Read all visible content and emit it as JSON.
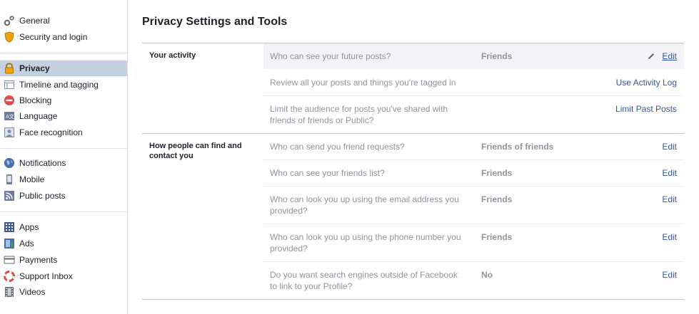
{
  "sidebar": {
    "groups": [
      [
        {
          "label": "General",
          "icon": "gear-icon"
        },
        {
          "label": "Security and login",
          "icon": "shield-icon"
        }
      ],
      [
        {
          "label": "Privacy",
          "icon": "lock-icon",
          "active": true
        },
        {
          "label": "Timeline and tagging",
          "icon": "timeline-icon"
        },
        {
          "label": "Blocking",
          "icon": "block-icon"
        },
        {
          "label": "Language",
          "icon": "language-icon"
        },
        {
          "label": "Face recognition",
          "icon": "face-recognition-icon"
        }
      ],
      [
        {
          "label": "Notifications",
          "icon": "globe-icon"
        },
        {
          "label": "Mobile",
          "icon": "mobile-icon"
        },
        {
          "label": "Public posts",
          "icon": "rss-icon"
        }
      ],
      [
        {
          "label": "Apps",
          "icon": "apps-icon"
        },
        {
          "label": "Ads",
          "icon": "ads-icon"
        },
        {
          "label": "Payments",
          "icon": "payments-icon"
        },
        {
          "label": "Support Inbox",
          "icon": "lifebuoy-icon"
        },
        {
          "label": "Videos",
          "icon": "film-icon"
        }
      ]
    ]
  },
  "main": {
    "title": "Privacy Settings and Tools",
    "sections": [
      {
        "title": "Your activity",
        "rows": [
          {
            "question": "Who can see your future posts?",
            "value": "Friends",
            "action": "Edit"
          },
          {
            "question": "Review all your posts and things you're tagged in",
            "value": "",
            "action": "Use Activity Log"
          },
          {
            "question": "Limit the audience for posts you've shared with friends of friends or Public?",
            "value": "",
            "action": "Limit Past Posts"
          }
        ]
      },
      {
        "title": "How people can find and contact you",
        "rows": [
          {
            "question": "Who can send you friend requests?",
            "value": "Friends of friends",
            "action": "Edit"
          },
          {
            "question": "Who can see your friends list?",
            "value": "Friends",
            "action": "Edit"
          },
          {
            "question": "Who can look you up using the email address you provided?",
            "value": "Friends",
            "action": "Edit"
          },
          {
            "question": "Who can look you up using the phone number you provided?",
            "value": "Friends",
            "action": "Edit"
          },
          {
            "question": "Do you want search engines outside of Facebook to link to your Profile?",
            "value": "No",
            "action": "Edit"
          }
        ]
      }
    ]
  },
  "colors": {
    "link": "#365899",
    "muted": "#90949c",
    "active_bg": "#c6d0e3",
    "hover_row": "#f2f3f5"
  }
}
